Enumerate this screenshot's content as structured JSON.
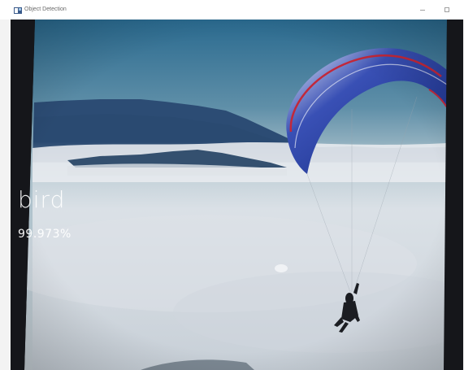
{
  "window": {
    "title": "Object Detection",
    "icon": "app-window-icon",
    "controls": {
      "minimize_icon": "minimize-icon",
      "maximize_icon": "maximize-icon"
    }
  },
  "detection": {
    "label": "bird",
    "confidence": "99.973%"
  },
  "colors": {
    "sky_top": "#2d6e93",
    "sky_bottom": "#b9cad0",
    "mountain": "#2f4e75",
    "cloud": "#d8dde3",
    "canopy_blue": "#1f3fa0",
    "canopy_red": "#c2283a",
    "overlay_text": "#ffffff"
  }
}
